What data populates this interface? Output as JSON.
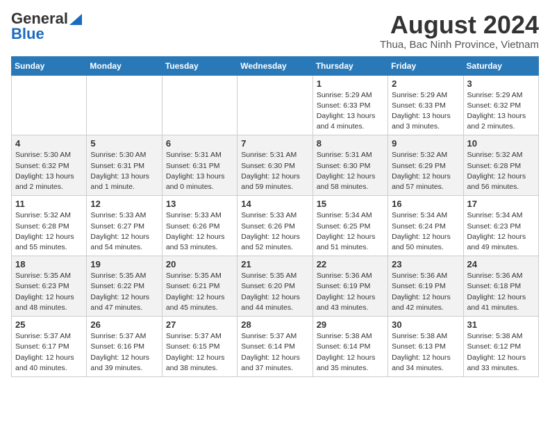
{
  "header": {
    "logo_general": "General",
    "logo_blue": "Blue",
    "month_year": "August 2024",
    "location": "Thua, Bac Ninh Province, Vietnam"
  },
  "weekdays": [
    "Sunday",
    "Monday",
    "Tuesday",
    "Wednesday",
    "Thursday",
    "Friday",
    "Saturday"
  ],
  "weeks": [
    [
      {
        "day": "",
        "info": ""
      },
      {
        "day": "",
        "info": ""
      },
      {
        "day": "",
        "info": ""
      },
      {
        "day": "",
        "info": ""
      },
      {
        "day": "1",
        "info": "Sunrise: 5:29 AM\nSunset: 6:33 PM\nDaylight: 13 hours\nand 4 minutes."
      },
      {
        "day": "2",
        "info": "Sunrise: 5:29 AM\nSunset: 6:33 PM\nDaylight: 13 hours\nand 3 minutes."
      },
      {
        "day": "3",
        "info": "Sunrise: 5:29 AM\nSunset: 6:32 PM\nDaylight: 13 hours\nand 2 minutes."
      }
    ],
    [
      {
        "day": "4",
        "info": "Sunrise: 5:30 AM\nSunset: 6:32 PM\nDaylight: 13 hours\nand 2 minutes."
      },
      {
        "day": "5",
        "info": "Sunrise: 5:30 AM\nSunset: 6:31 PM\nDaylight: 13 hours\nand 1 minute."
      },
      {
        "day": "6",
        "info": "Sunrise: 5:31 AM\nSunset: 6:31 PM\nDaylight: 13 hours\nand 0 minutes."
      },
      {
        "day": "7",
        "info": "Sunrise: 5:31 AM\nSunset: 6:30 PM\nDaylight: 12 hours\nand 59 minutes."
      },
      {
        "day": "8",
        "info": "Sunrise: 5:31 AM\nSunset: 6:30 PM\nDaylight: 12 hours\nand 58 minutes."
      },
      {
        "day": "9",
        "info": "Sunrise: 5:32 AM\nSunset: 6:29 PM\nDaylight: 12 hours\nand 57 minutes."
      },
      {
        "day": "10",
        "info": "Sunrise: 5:32 AM\nSunset: 6:28 PM\nDaylight: 12 hours\nand 56 minutes."
      }
    ],
    [
      {
        "day": "11",
        "info": "Sunrise: 5:32 AM\nSunset: 6:28 PM\nDaylight: 12 hours\nand 55 minutes."
      },
      {
        "day": "12",
        "info": "Sunrise: 5:33 AM\nSunset: 6:27 PM\nDaylight: 12 hours\nand 54 minutes."
      },
      {
        "day": "13",
        "info": "Sunrise: 5:33 AM\nSunset: 6:26 PM\nDaylight: 12 hours\nand 53 minutes."
      },
      {
        "day": "14",
        "info": "Sunrise: 5:33 AM\nSunset: 6:26 PM\nDaylight: 12 hours\nand 52 minutes."
      },
      {
        "day": "15",
        "info": "Sunrise: 5:34 AM\nSunset: 6:25 PM\nDaylight: 12 hours\nand 51 minutes."
      },
      {
        "day": "16",
        "info": "Sunrise: 5:34 AM\nSunset: 6:24 PM\nDaylight: 12 hours\nand 50 minutes."
      },
      {
        "day": "17",
        "info": "Sunrise: 5:34 AM\nSunset: 6:23 PM\nDaylight: 12 hours\nand 49 minutes."
      }
    ],
    [
      {
        "day": "18",
        "info": "Sunrise: 5:35 AM\nSunset: 6:23 PM\nDaylight: 12 hours\nand 48 minutes."
      },
      {
        "day": "19",
        "info": "Sunrise: 5:35 AM\nSunset: 6:22 PM\nDaylight: 12 hours\nand 47 minutes."
      },
      {
        "day": "20",
        "info": "Sunrise: 5:35 AM\nSunset: 6:21 PM\nDaylight: 12 hours\nand 45 minutes."
      },
      {
        "day": "21",
        "info": "Sunrise: 5:35 AM\nSunset: 6:20 PM\nDaylight: 12 hours\nand 44 minutes."
      },
      {
        "day": "22",
        "info": "Sunrise: 5:36 AM\nSunset: 6:19 PM\nDaylight: 12 hours\nand 43 minutes."
      },
      {
        "day": "23",
        "info": "Sunrise: 5:36 AM\nSunset: 6:19 PM\nDaylight: 12 hours\nand 42 minutes."
      },
      {
        "day": "24",
        "info": "Sunrise: 5:36 AM\nSunset: 6:18 PM\nDaylight: 12 hours\nand 41 minutes."
      }
    ],
    [
      {
        "day": "25",
        "info": "Sunrise: 5:37 AM\nSunset: 6:17 PM\nDaylight: 12 hours\nand 40 minutes."
      },
      {
        "day": "26",
        "info": "Sunrise: 5:37 AM\nSunset: 6:16 PM\nDaylight: 12 hours\nand 39 minutes."
      },
      {
        "day": "27",
        "info": "Sunrise: 5:37 AM\nSunset: 6:15 PM\nDaylight: 12 hours\nand 38 minutes."
      },
      {
        "day": "28",
        "info": "Sunrise: 5:37 AM\nSunset: 6:14 PM\nDaylight: 12 hours\nand 37 minutes."
      },
      {
        "day": "29",
        "info": "Sunrise: 5:38 AM\nSunset: 6:14 PM\nDaylight: 12 hours\nand 35 minutes."
      },
      {
        "day": "30",
        "info": "Sunrise: 5:38 AM\nSunset: 6:13 PM\nDaylight: 12 hours\nand 34 minutes."
      },
      {
        "day": "31",
        "info": "Sunrise: 5:38 AM\nSunset: 6:12 PM\nDaylight: 12 hours\nand 33 minutes."
      }
    ]
  ]
}
